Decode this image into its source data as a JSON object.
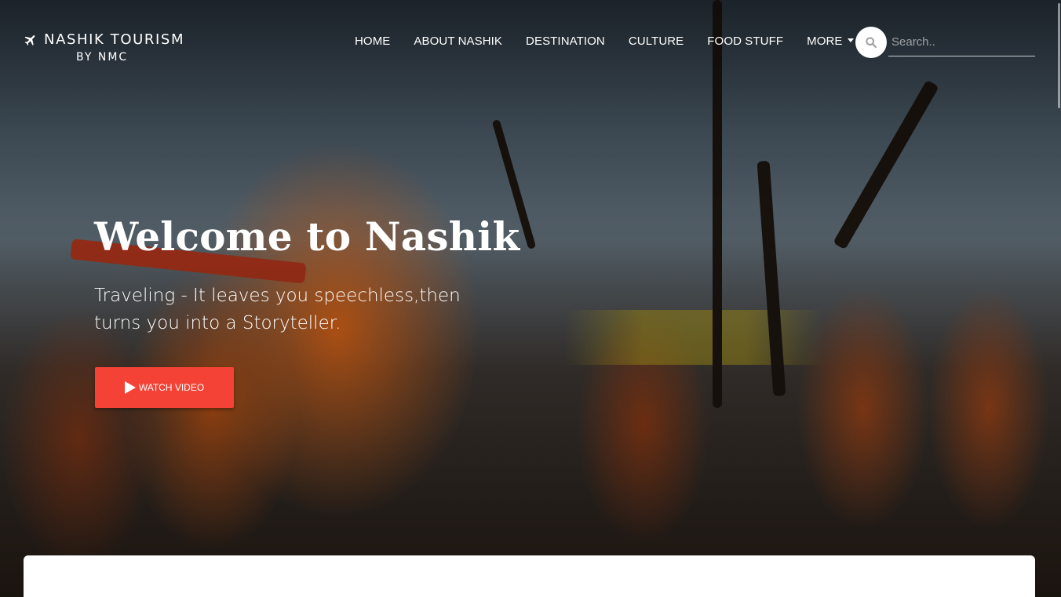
{
  "brand": {
    "title": "NASHIK TOURISM",
    "subtitle": "BY NMC",
    "icon": "plane-icon"
  },
  "nav": {
    "items": [
      {
        "label": "HOME"
      },
      {
        "label": "ABOUT NASHIK"
      },
      {
        "label": "DESTINATION"
      },
      {
        "label": "CULTURE"
      },
      {
        "label": "FOOD STUFF"
      },
      {
        "label": "MORE",
        "has_dropdown": true
      }
    ]
  },
  "search": {
    "placeholder": "Search..",
    "value": "",
    "icon": "search-icon"
  },
  "hero": {
    "title": "Welcome to Nashik",
    "subtitle": "Traveling - It leaves you speechless,then turns you into a Storyteller.",
    "cta_label": "WATCH VIDEO",
    "cta_icon": "play-icon"
  },
  "colors": {
    "accent": "#f44336",
    "text": "#ffffff",
    "card": "#ffffff"
  }
}
